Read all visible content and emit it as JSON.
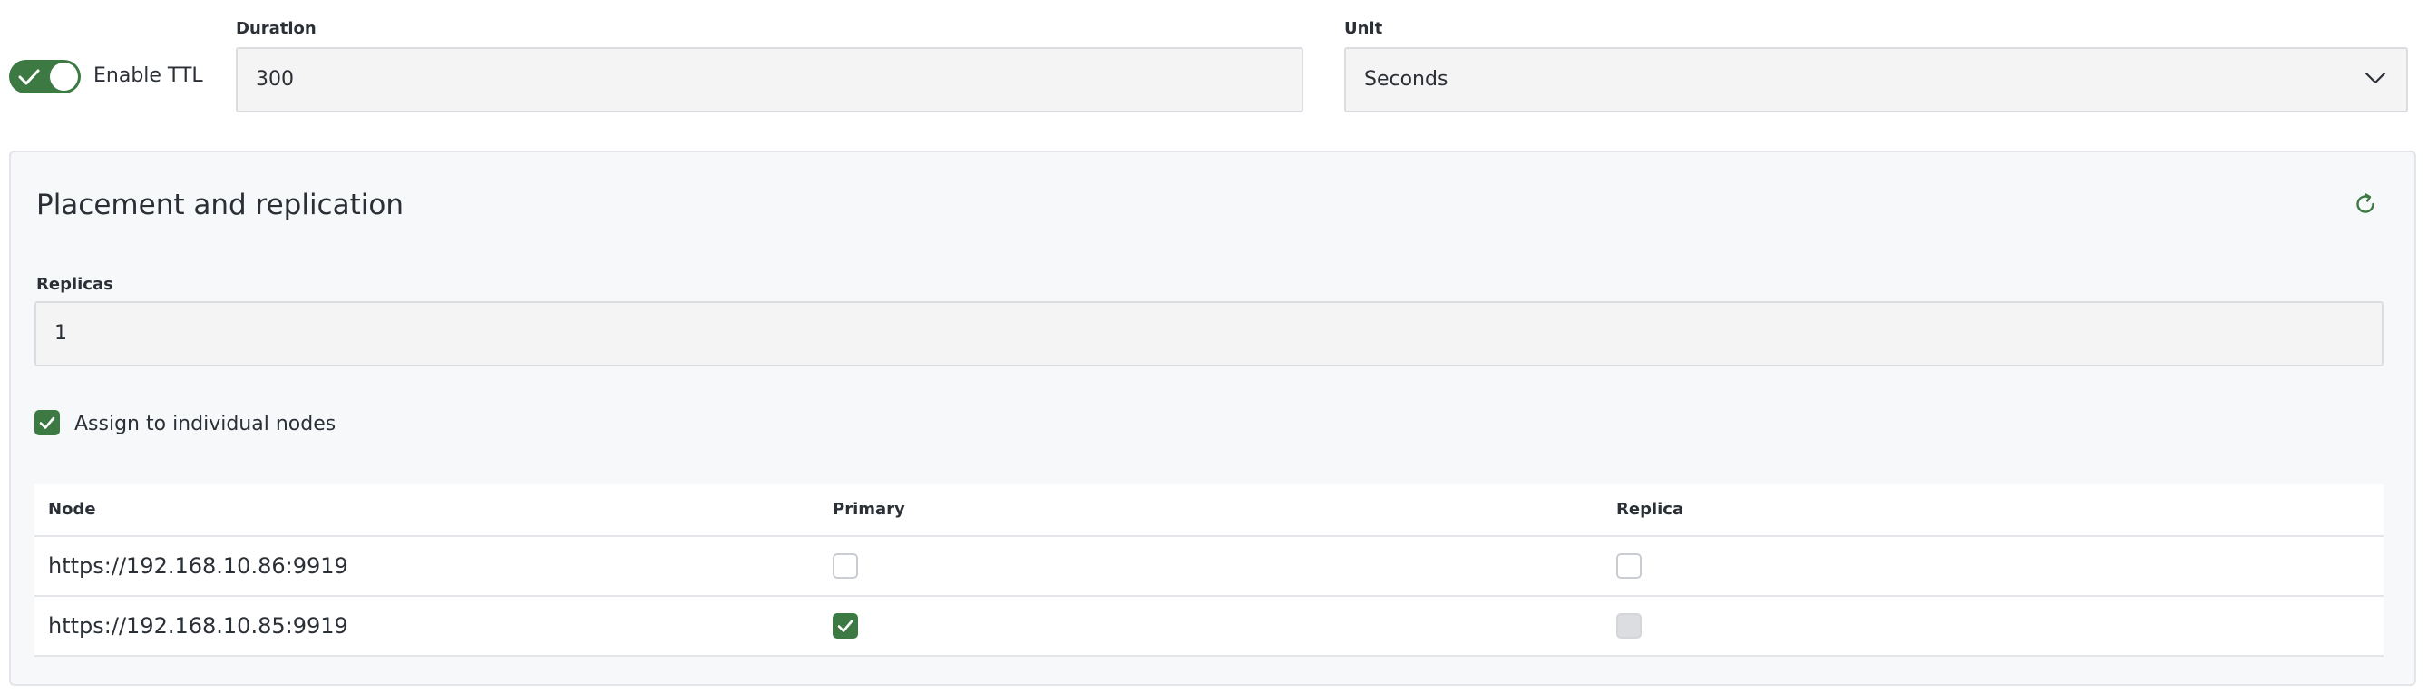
{
  "ttl": {
    "enable_label": "Enable TTL",
    "enabled": true,
    "duration_label": "Duration",
    "duration_value": "300",
    "unit_label": "Unit",
    "unit_value": "Seconds"
  },
  "placement": {
    "title": "Placement and replication",
    "replicas_label": "Replicas",
    "replicas_value": "1",
    "assign_label": "Assign to individual nodes",
    "assign_checked": true,
    "table": {
      "columns": [
        "Node",
        "Primary",
        "Replica"
      ],
      "rows": [
        {
          "node": "https://192.168.10.86:9919",
          "primary": "unchecked",
          "replica": "unchecked"
        },
        {
          "node": "https://192.168.10.85:9919",
          "primary": "checked",
          "replica": "disabled"
        }
      ]
    }
  },
  "colors": {
    "accent": "#3d7a43",
    "input_bg": "#f4f4f5",
    "panel_bg": "#f7f8fa"
  },
  "icons": {
    "toggle": "check-icon",
    "unit_select": "chevron-down-icon",
    "refresh": "refresh-icon"
  }
}
